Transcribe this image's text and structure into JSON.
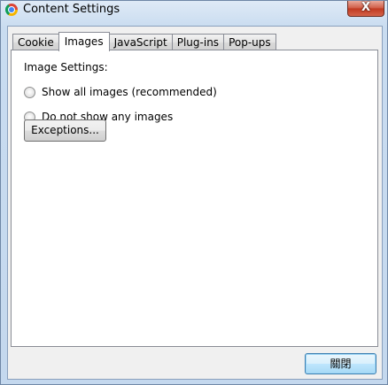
{
  "window": {
    "title": "Content Settings",
    "close_glyph": "X"
  },
  "tabs": [
    {
      "label": "Cookie",
      "selected": false
    },
    {
      "label": "Images",
      "selected": true
    },
    {
      "label": "JavaScript",
      "selected": false
    },
    {
      "label": "Plug-ins",
      "selected": false
    },
    {
      "label": "Pop-ups",
      "selected": false
    }
  ],
  "images_panel": {
    "group_label": "Image Settings:",
    "options": [
      {
        "label": "Show all images (recommended)",
        "checked": false
      },
      {
        "label": "Do not show any images",
        "checked": false
      }
    ],
    "exceptions_label": "Exceptions..."
  },
  "footer": {
    "close_label": "關閉"
  }
}
